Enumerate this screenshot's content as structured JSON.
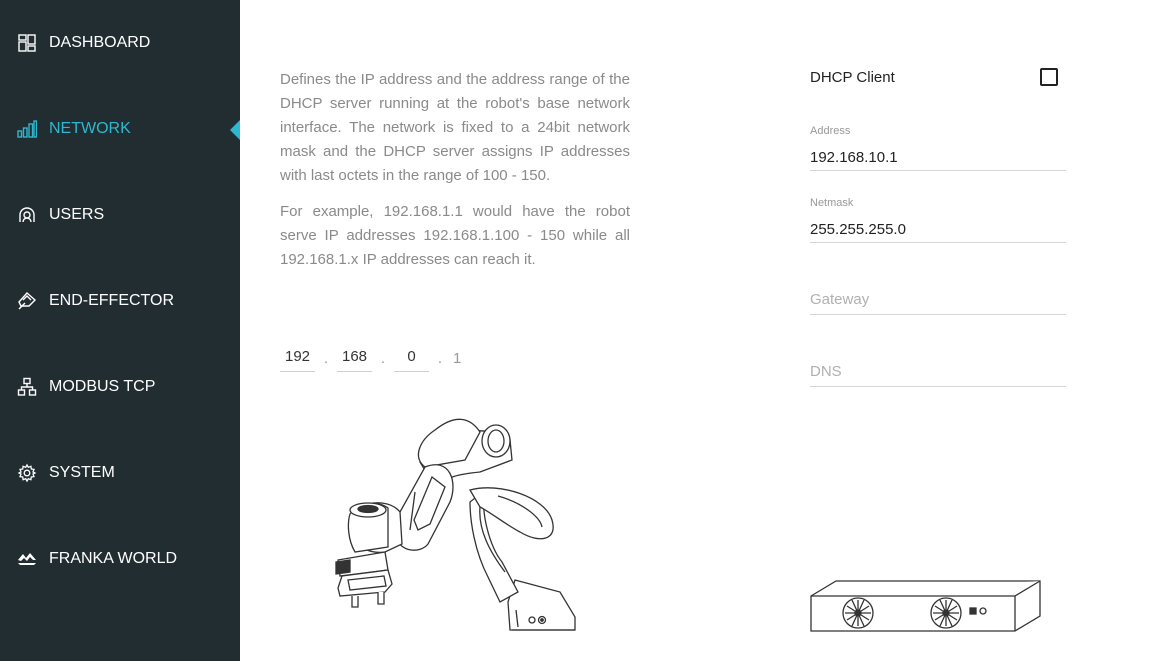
{
  "sidebar": {
    "items": [
      {
        "label": "DASHBOARD",
        "icon": "dashboard-icon"
      },
      {
        "label": "NETWORK",
        "icon": "network-icon",
        "active": true
      },
      {
        "label": "USERS",
        "icon": "users-icon"
      },
      {
        "label": "END-EFFECTOR",
        "icon": "end-effector-icon"
      },
      {
        "label": "MODBUS TCP",
        "icon": "modbus-icon"
      },
      {
        "label": "SYSTEM",
        "icon": "gear-icon"
      },
      {
        "label": "FRANKA WORLD",
        "icon": "franka-world-icon"
      }
    ]
  },
  "colors": {
    "sidebar_bg": "#222d32",
    "accent": "#2fb7d0"
  },
  "description": {
    "paragraph1": "Defines the IP address and the address range of the DHCP server running at the robot's base network interface. The network is fixed to a 24bit network mask and the DHCP server assigns IP addresses with last octets in the range of 100 - 150.",
    "paragraph2": "For example, 192.168.1.1 would have the robot serve IP addresses 192.168.1.100 - 150 while all 192.168.1.x IP addresses can reach it."
  },
  "ip": {
    "octet1": "192",
    "octet2": "168",
    "octet3": "0",
    "octet4": "1",
    "separator": "."
  },
  "form": {
    "dhcp_label": "DHCP Client",
    "dhcp_checked": false,
    "address_label": "Address",
    "address_value": "192.168.10.1",
    "netmask_label": "Netmask",
    "netmask_value": "255.255.255.0",
    "gateway_placeholder": "Gateway",
    "dns_placeholder": "DNS"
  }
}
